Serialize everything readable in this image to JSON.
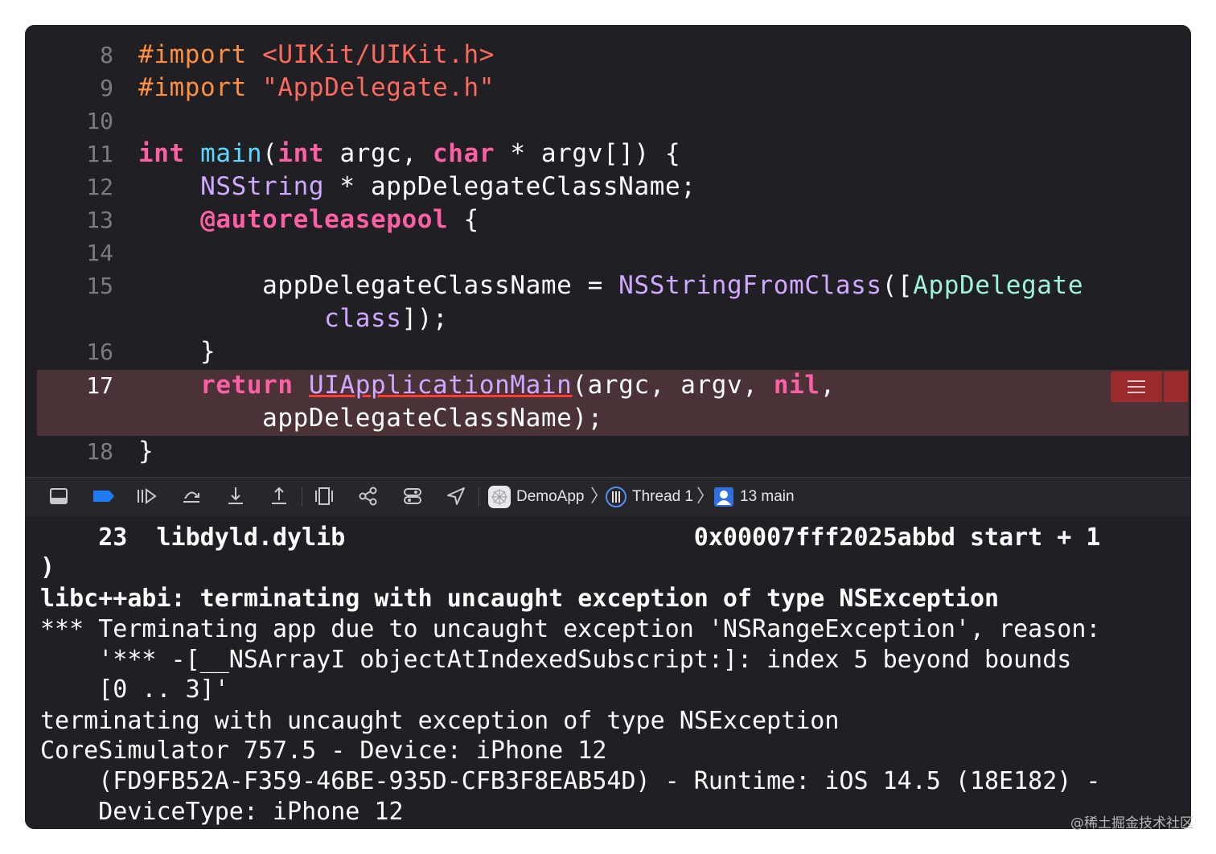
{
  "editor": {
    "lines": [
      {
        "num": "8",
        "segments": [
          {
            "t": "#import ",
            "c": "k-pre"
          },
          {
            "t": "<UIKit/UIKit.h>",
            "c": "k-str"
          }
        ]
      },
      {
        "num": "9",
        "segments": [
          {
            "t": "#import ",
            "c": "k-pre"
          },
          {
            "t": "\"AppDelegate.h\"",
            "c": "k-str"
          }
        ]
      },
      {
        "num": "10",
        "segments": []
      },
      {
        "num": "11",
        "segments": [
          {
            "t": "int",
            "c": "k-key"
          },
          {
            "t": " "
          },
          {
            "t": "main",
            "c": "k-type"
          },
          {
            "t": "("
          },
          {
            "t": "int",
            "c": "k-key"
          },
          {
            "t": " argc, "
          },
          {
            "t": "char",
            "c": "k-key"
          },
          {
            "t": " * argv[]) {"
          }
        ]
      },
      {
        "num": "12",
        "segments": [
          {
            "t": "    "
          },
          {
            "t": "NSString",
            "c": "k-cls"
          },
          {
            "t": " * appDelegateClassName;"
          }
        ]
      },
      {
        "num": "13",
        "segments": [
          {
            "t": "    "
          },
          {
            "t": "@autoreleasepool",
            "c": "k-key"
          },
          {
            "t": " {"
          }
        ]
      },
      {
        "num": "14",
        "segments": []
      },
      {
        "num": "15",
        "segments": [
          {
            "t": "        appDelegateClassName = "
          },
          {
            "t": "NSStringFromClass",
            "c": "k-cls"
          },
          {
            "t": "(["
          },
          {
            "t": "AppDelegate",
            "c": "k-ty2"
          }
        ]
      },
      {
        "num": "",
        "segments": [
          {
            "t": "            "
          },
          {
            "t": "class",
            "c": "k-cls"
          },
          {
            "t": "]);"
          }
        ]
      },
      {
        "num": "16",
        "segments": [
          {
            "t": "    }"
          }
        ]
      },
      {
        "num": "17",
        "segments": [
          {
            "t": "    "
          },
          {
            "t": "return",
            "c": "k-key"
          },
          {
            "t": " "
          },
          {
            "t": "UIApplicationMain",
            "c": "k-err"
          },
          {
            "t": "(argc, argv, "
          },
          {
            "t": "nil",
            "c": "k-key"
          },
          {
            "t": ","
          }
        ]
      },
      {
        "num": "",
        "segments": [
          {
            "t": "        appDelegateClassName);"
          }
        ]
      },
      {
        "num": "18",
        "segments": [
          {
            "t": "}"
          }
        ]
      }
    ]
  },
  "toolbar": {
    "icons": [
      "hide-debug-area-icon",
      "breakpoints-toggle-icon",
      "continue-icon",
      "step-over-icon",
      "step-into-icon",
      "step-out-icon",
      "debug-view-hierarchy-icon",
      "memory-graph-icon",
      "environment-overrides-icon",
      "simulate-location-icon"
    ],
    "breadcrumb": {
      "app": "DemoApp",
      "thread": "Thread 1",
      "frame": "13 main"
    }
  },
  "console": {
    "lines": [
      {
        "text": "    23  libdyld.dylib                        0x00007fff2025abbd start + 1",
        "bold": true
      },
      {
        "text": ")",
        "bold": true
      },
      {
        "text": "libc++abi: terminating with uncaught exception of type NSException",
        "bold": true
      },
      {
        "text": "*** Terminating app due to uncaught exception 'NSRangeException', reason:",
        "bold": false
      },
      {
        "text": "    '*** -[__NSArrayI objectAtIndexedSubscript:]: index 5 beyond bounds",
        "bold": false
      },
      {
        "text": "    [0 .. 3]'",
        "bold": false
      },
      {
        "text": "terminating with uncaught exception of type NSException",
        "bold": false
      },
      {
        "text": "CoreSimulator 757.5 - Device: iPhone 12",
        "bold": false
      },
      {
        "text": "    (FD9FB52A-F359-46BE-935D-CFB3F8EAB54D) - Runtime: iOS 14.5 (18E182) -",
        "bold": false
      },
      {
        "text": "    DeviceType: iPhone 12",
        "bold": false
      }
    ]
  },
  "watermark": "@稀土掘金技术社区"
}
